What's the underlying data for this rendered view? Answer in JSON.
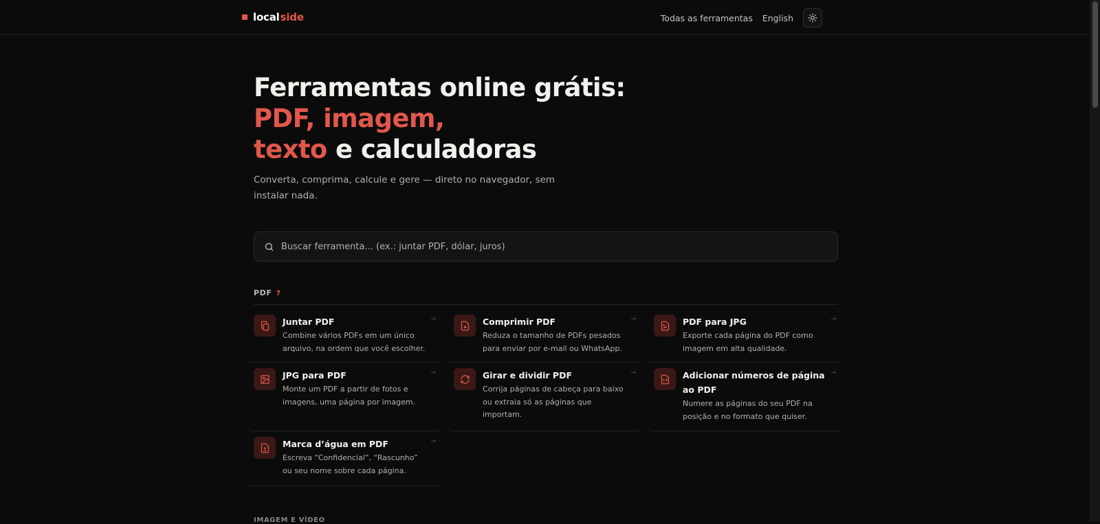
{
  "brand": {
    "part1": "local",
    "part2": "side"
  },
  "nav": {
    "all_tools": "Todas as ferramentas",
    "language": "English",
    "theme_icon": "sun-icon"
  },
  "hero": {
    "title_a": "Ferramentas online grátis: ",
    "title_accent_a": "PDF, imagem,",
    "title_accent_b": "texto",
    "title_b": " e calculadoras",
    "subtitle": "Converta, comprima, calcule e gere — direto no navegador, sem instalar nada."
  },
  "search": {
    "placeholder": "Buscar ferramenta... (ex.: juntar PDF, dólar, juros)",
    "value": ""
  },
  "sections": [
    {
      "label": "PDF",
      "count": "7",
      "tools": [
        {
          "title": "Juntar PDF",
          "desc": "Combine vários PDFs em um único arquivo, na ordem que você escolher.",
          "icon": "files-icon"
        },
        {
          "title": "Comprimir PDF",
          "desc": "Reduza o tamanho de PDFs pesados para enviar por e-mail ou WhatsApp.",
          "icon": "file-download-icon"
        },
        {
          "title": "PDF para JPG",
          "desc": "Exporte cada página do PDF como imagem em alta qualidade.",
          "icon": "file-image-icon"
        },
        {
          "title": "JPG para PDF",
          "desc": "Monte um PDF a partir de fotos e imagens, uma página por imagem.",
          "icon": "image-icon"
        },
        {
          "title": "Girar e dividir PDF",
          "desc": "Corrija páginas de cabeça para baixo ou extraia só as páginas que importam.",
          "icon": "rotate-icon"
        },
        {
          "title": "Adicionar números de página ao PDF",
          "desc": "Numere as páginas do seu PDF na posição e no formato que quiser.",
          "icon": "file-number-icon"
        },
        {
          "title": "Marca d’água em PDF",
          "desc": "Escreva “Confidencial”, “Rascunho” ou seu nome sobre cada página.",
          "icon": "file-stamp-icon"
        }
      ]
    },
    {
      "label": "IMAGEM E VÍDEO"
    }
  ],
  "colors": {
    "accent": "#e2574c",
    "background": "#0b0b0b",
    "icon_bg": "#3a1816"
  }
}
